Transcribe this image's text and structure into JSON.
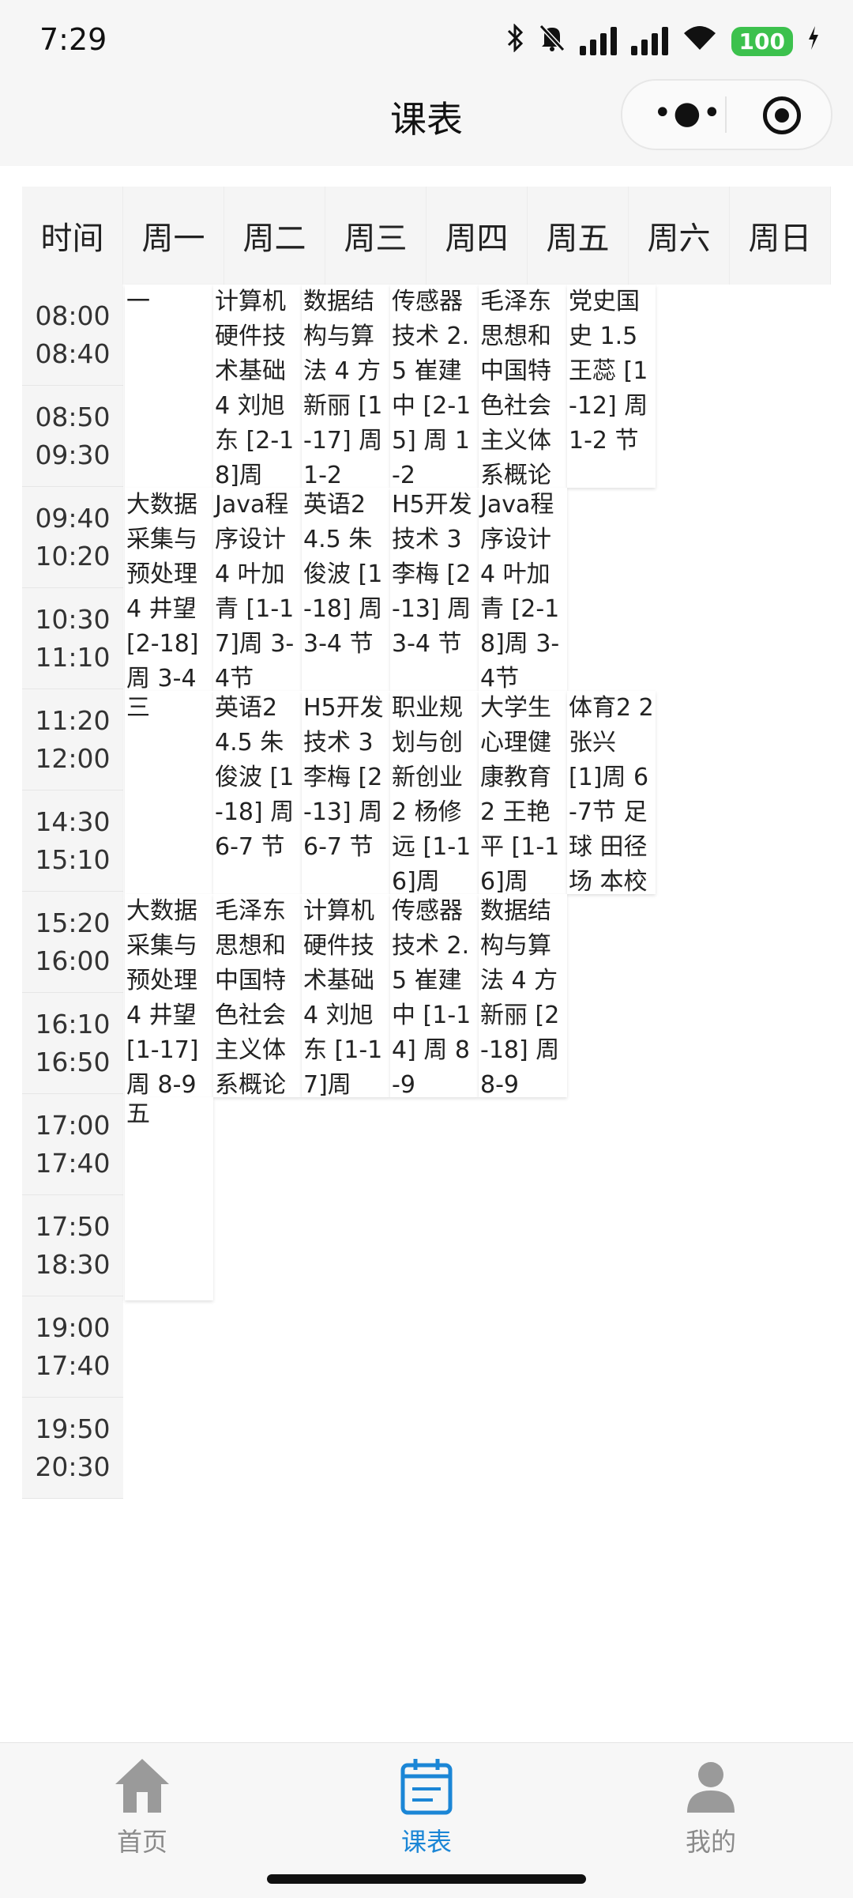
{
  "status_bar": {
    "time": "7:29",
    "battery": "100"
  },
  "nav": {
    "title": "课表"
  },
  "header": [
    "时间",
    "周一",
    "周二",
    "周三",
    "周四",
    "周五",
    "周六",
    "周日"
  ],
  "time_slots": [
    [
      "08:00",
      "08:40"
    ],
    [
      "08:50",
      "09:30"
    ],
    [
      "09:40",
      "10:20"
    ],
    [
      "10:30",
      "11:10"
    ],
    [
      "11:20",
      "12:00"
    ],
    [
      "14:30",
      "15:10"
    ],
    [
      "15:20",
      "16:00"
    ],
    [
      "16:10",
      "16:50"
    ],
    [
      "17:00",
      "17:40"
    ],
    [
      "17:50",
      "18:30"
    ],
    [
      "19:00",
      "17:40"
    ],
    [
      "19:50",
      "20:30"
    ]
  ],
  "courses": [
    {
      "col": 0,
      "block": 0,
      "text": "一"
    },
    {
      "col": 1,
      "block": 0,
      "text": "计算机硬件技术基础 4 刘旭东 [2-18]周"
    },
    {
      "col": 2,
      "block": 0,
      "text": "数据结构与算法 4 方新丽 [1-17] 周 1-2"
    },
    {
      "col": 3,
      "block": 0,
      "text": "传感器技术 2.5 崔建中 [2-15] 周 1-2"
    },
    {
      "col": 4,
      "block": 0,
      "text": "毛泽东思想和中国特色社会主义体系概论"
    },
    {
      "col": 5,
      "block": 0,
      "text": "党史国史 1.5 王蕊 [1-12] 周 1-2 节"
    },
    {
      "col": 0,
      "block": 1,
      "text": "大数据采集与预处理 4 井望 [2-18] 周 3-4"
    },
    {
      "col": 1,
      "block": 1,
      "text": "Java程序设计 4 叶加青 [1-17]周 3-4节"
    },
    {
      "col": 2,
      "block": 1,
      "text": "英语2 4.5 朱俊波 [1-18] 周 3-4 节"
    },
    {
      "col": 3,
      "block": 1,
      "text": "H5开发技术 3 李梅 [2-13] 周 3-4 节"
    },
    {
      "col": 4,
      "block": 1,
      "text": "Java程序设计 4 叶加青 [2-18]周 3-4节"
    },
    {
      "col": 0,
      "block": 2,
      "text": "三"
    },
    {
      "col": 1,
      "block": 2,
      "text": "英语2 4.5 朱俊波 [1-18] 周 6-7 节"
    },
    {
      "col": 2,
      "block": 2,
      "text": "H5开发技术 3 李梅 [2-13] 周 6-7 节"
    },
    {
      "col": 3,
      "block": 2,
      "text": "职业规划与创新创业 2 杨修远 [1-16]周"
    },
    {
      "col": 4,
      "block": 2,
      "text": "大学生心理健康教育 2 王艳平 [1-16]周"
    },
    {
      "col": 5,
      "block": 2,
      "text": "体育2 2 张兴 [1]周 6-7节 足球 田径场 本校"
    },
    {
      "col": 0,
      "block": 3,
      "text": "大数据采集与预处理 4 井望 [1-17] 周 8-9"
    },
    {
      "col": 1,
      "block": 3,
      "text": "毛泽东思想和中国特色社会主义体系概论"
    },
    {
      "col": 2,
      "block": 3,
      "text": "计算机硬件技术基础 4 刘旭东 [1-17]周"
    },
    {
      "col": 3,
      "block": 3,
      "text": "传感器技术 2.5 崔建中 [1-14] 周 8-9"
    },
    {
      "col": 4,
      "block": 3,
      "text": "数据结构与算法 4 方新丽 [2-18] 周 8-9"
    },
    {
      "col": 0,
      "block": 4,
      "text": "五"
    }
  ],
  "tabs": [
    {
      "label": "首页",
      "icon": "home-icon",
      "active": false
    },
    {
      "label": "课表",
      "icon": "schedule-icon",
      "active": true
    },
    {
      "label": "我的",
      "icon": "user-icon",
      "active": false
    }
  ],
  "colors": {
    "accent": "#1b86d6",
    "inactive": "#8a8a8a"
  }
}
